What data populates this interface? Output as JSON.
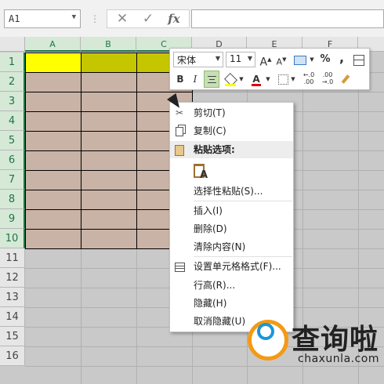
{
  "formula_bar": {
    "name_box": "A1",
    "cancel_icon": "✕",
    "enter_icon": "✓",
    "fx_label": "fx",
    "formula": ""
  },
  "columns": [
    "A",
    "B",
    "C",
    "D",
    "E",
    "F"
  ],
  "rows": [
    "1",
    "2",
    "3",
    "4",
    "5",
    "6",
    "7",
    "8",
    "9",
    "10",
    "11",
    "12",
    "13",
    "14",
    "15",
    "16"
  ],
  "colors": {
    "header_yellow": "#ffff00",
    "header_olive": "#c6c600",
    "body_tan": "#c9b3a6",
    "sheet_gray": "#c9c9c9",
    "selected_header": "#217346",
    "watermark_orange": "#f39a14",
    "watermark_blue": "#1a96d8"
  },
  "mini_toolbar": {
    "font_name": "宋体",
    "font_size": "11",
    "grow_font": "A",
    "shrink_font": "A",
    "percent": "%",
    "comma": ",",
    "bold": "B",
    "italic": "I",
    "font_color_letter": "A",
    "increase_decimal": "←.0 .00",
    "decrease_decimal": ".00 →.0"
  },
  "context_menu": {
    "items": [
      {
        "label": "剪切(T)",
        "icon": "cut-icon"
      },
      {
        "label": "复制(C)",
        "icon": "copy-icon"
      },
      {
        "label": "粘贴选项:",
        "icon": "paste-icon"
      },
      {
        "label": "选择性粘贴(S)...",
        "icon": ""
      },
      {
        "label": "插入(I)",
        "icon": ""
      },
      {
        "label": "删除(D)",
        "icon": ""
      },
      {
        "label": "清除内容(N)",
        "icon": ""
      },
      {
        "label": "设置单元格格式(F)...",
        "icon": "format-cells-icon"
      },
      {
        "label": "行高(R)...",
        "icon": ""
      },
      {
        "label": "隐藏(H)",
        "icon": ""
      },
      {
        "label": "取消隐藏(U)",
        "icon": ""
      }
    ]
  },
  "watermark": {
    "text": "查询啦",
    "url": "chaxunla.com"
  }
}
